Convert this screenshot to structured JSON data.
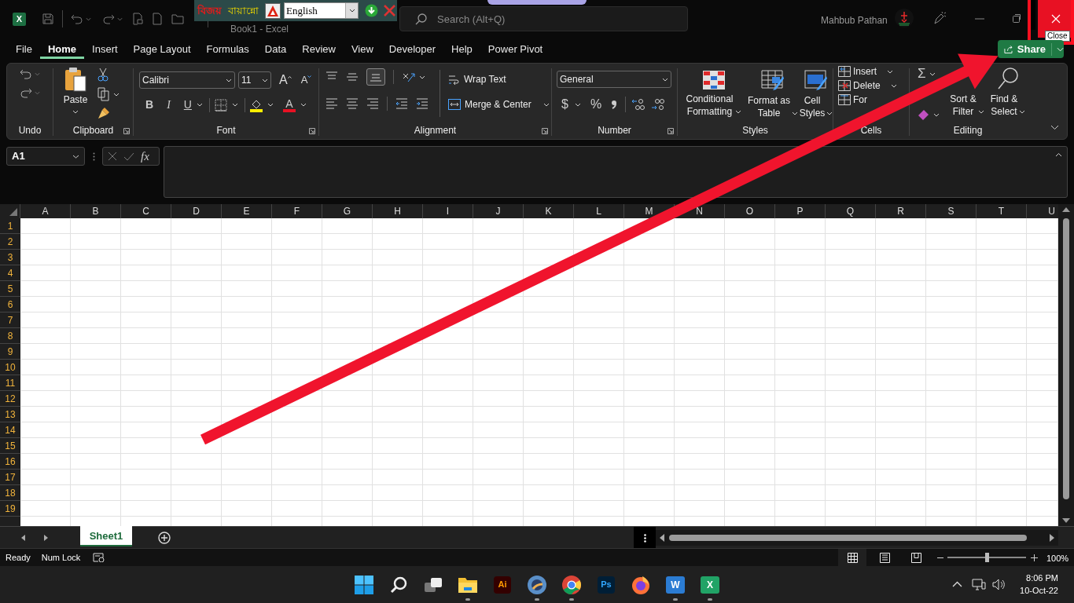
{
  "title_bar": {
    "app_letter": "X",
    "document_title": "Book1 - Excel",
    "search_placeholder": "Search (Alt+Q)",
    "user_name": "Mahbub Pathan",
    "close_tooltip": "Close"
  },
  "keyboard_toolbar": {
    "logo": "বিজয়",
    "layout": "বায়ান্নো",
    "language": "English"
  },
  "tabs": [
    {
      "label": "File",
      "selected": false
    },
    {
      "label": "Home",
      "selected": true
    },
    {
      "label": "Insert",
      "selected": false
    },
    {
      "label": "Page Layout",
      "selected": false
    },
    {
      "label": "Formulas",
      "selected": false
    },
    {
      "label": "Data",
      "selected": false
    },
    {
      "label": "Review",
      "selected": false
    },
    {
      "label": "View",
      "selected": false
    },
    {
      "label": "Developer",
      "selected": false
    },
    {
      "label": "Help",
      "selected": false
    },
    {
      "label": "Power Pivot",
      "selected": false
    }
  ],
  "share_button": "Share",
  "ribbon": {
    "undo": {
      "label": "Undo"
    },
    "clipboard": {
      "label": "Clipboard",
      "paste": "Paste"
    },
    "font": {
      "label": "Font",
      "font_name": "Calibri",
      "font_size": "11",
      "grow_font": "A",
      "shrink_font": "A",
      "bold": "B",
      "italic": "I",
      "underline": "U",
      "font_color": "A"
    },
    "alignment": {
      "label": "Alignment",
      "wrap_text": "Wrap Text",
      "merge_center": "Merge & Center"
    },
    "number": {
      "label": "Number",
      "format": "General",
      "currency": "$",
      "percent": "%"
    },
    "styles": {
      "label": "Styles",
      "buttons": [
        {
          "lines": [
            "Conditional",
            "Formatting"
          ]
        },
        {
          "lines": [
            "Format as",
            "Table"
          ]
        },
        {
          "lines": [
            "Cell",
            "Styles"
          ]
        }
      ]
    },
    "cells": {
      "label": "Cells",
      "buttons": [
        "Insert",
        "Delete",
        "For"
      ]
    },
    "editing": {
      "label": "Editing",
      "autosum": "Σ",
      "buttons": [
        {
          "lines": [
            "Sort &",
            "Filter"
          ]
        },
        {
          "lines": [
            "Find &",
            "Select"
          ]
        }
      ]
    }
  },
  "formula_bar": {
    "name_box": "A1",
    "function_label": "fx"
  },
  "sheet": {
    "columns": [
      "A",
      "B",
      "C",
      "D",
      "E",
      "F",
      "G",
      "H",
      "I",
      "J",
      "K",
      "L",
      "M",
      "N",
      "O",
      "P",
      "Q",
      "R",
      "S",
      "T",
      "U"
    ],
    "rows": [
      "1",
      "2",
      "3",
      "4",
      "5",
      "6",
      "7",
      "8",
      "9",
      "10",
      "11",
      "12",
      "13",
      "14",
      "15",
      "16",
      "17",
      "18",
      "19"
    ]
  },
  "sheet_tabs": [
    {
      "label": "Sheet1",
      "selected": true
    }
  ],
  "status_bar": {
    "items": [
      "Ready",
      "Num Lock"
    ],
    "zoom_slider": {
      "level": 0.5
    },
    "zoom": "100%"
  },
  "taskbar": {
    "apps": [
      {
        "kind": "start",
        "running": false
      },
      {
        "kind": "search",
        "running": false
      },
      {
        "kind": "task-view",
        "running": false
      },
      {
        "kind": "folder",
        "running": true
      },
      {
        "kind": "illustrator",
        "text": "Ai",
        "running": false
      },
      {
        "kind": "photo",
        "running": true
      },
      {
        "kind": "chrome",
        "running": true
      },
      {
        "kind": "photoshop",
        "text": "Ps",
        "running": false
      },
      {
        "kind": "firefox",
        "running": false
      },
      {
        "kind": "word",
        "text": "W",
        "running": true
      },
      {
        "kind": "excel",
        "text": "X",
        "running": true
      }
    ],
    "time": "8:06 PM",
    "date": "10-Oct-22"
  }
}
